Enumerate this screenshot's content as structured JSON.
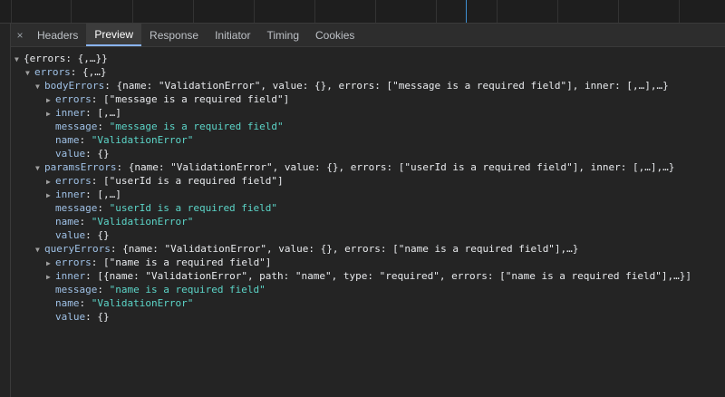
{
  "tabs": {
    "close_icon": "×",
    "items": [
      {
        "label": "Headers"
      },
      {
        "label": "Preview"
      },
      {
        "label": "Response"
      },
      {
        "label": "Initiator"
      },
      {
        "label": "Timing"
      },
      {
        "label": "Cookies"
      }
    ],
    "active": "Preview"
  },
  "tree": {
    "root": {
      "text": "{errors: {,…}}"
    },
    "errors": {
      "key": "errors",
      "preview": "{,…}"
    },
    "bodyErrors": {
      "key": "bodyErrors",
      "preview": "{name: \"ValidationError\", value: {}, errors: [\"message is a required field\"], inner: [,…],…}",
      "errors_key": "errors",
      "errors_preview": "[\"message is a required field\"]",
      "inner_key": "inner",
      "inner_preview": "[,…]",
      "message_key": "message",
      "message_value": "\"message is a required field\"",
      "name_key": "name",
      "name_value": "\"ValidationError\"",
      "value_key": "value",
      "value_value": "{}"
    },
    "paramsErrors": {
      "key": "paramsErrors",
      "preview": "{name: \"ValidationError\", value: {}, errors: [\"userId is a required field\"], inner: [,…],…}",
      "errors_key": "errors",
      "errors_preview": "[\"userId is a required field\"]",
      "inner_key": "inner",
      "inner_preview": "[,…]",
      "message_key": "message",
      "message_value": "\"userId is a required field\"",
      "name_key": "name",
      "name_value": "\"ValidationError\"",
      "value_key": "value",
      "value_value": "{}"
    },
    "queryErrors": {
      "key": "queryErrors",
      "preview": "{name: \"ValidationError\", value: {}, errors: [\"name is a required field\"],…}",
      "errors_key": "errors",
      "errors_preview": "[\"name is a required field\"]",
      "inner_key": "inner",
      "inner_preview": "[{name: \"ValidationError\", path: \"name\", type: \"required\", errors: [\"name is a required field\"],…}]",
      "message_key": "message",
      "message_value": "\"name is a required field\"",
      "name_key": "name",
      "name_value": "\"ValidationError\"",
      "value_key": "value",
      "value_value": "{}"
    }
  }
}
